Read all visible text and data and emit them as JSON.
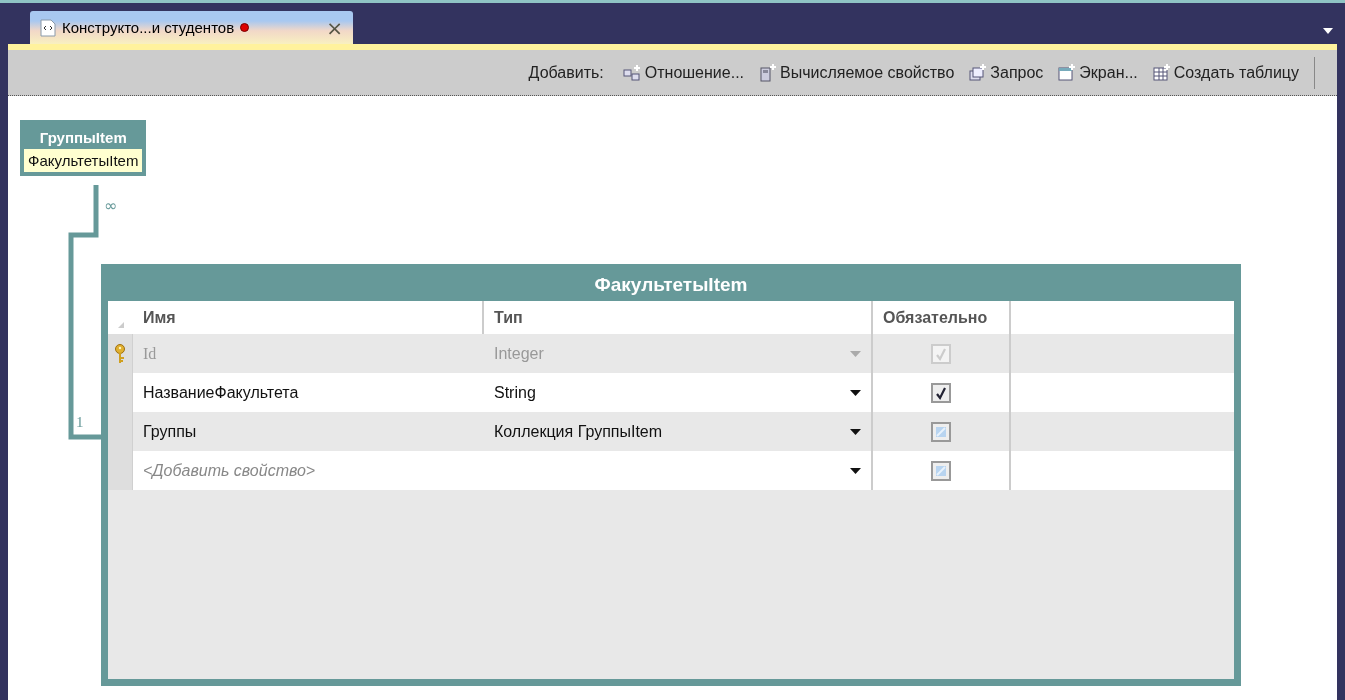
{
  "tab": {
    "title": "Конструкто...и студентов",
    "modified": true,
    "close": "×"
  },
  "toolbar": {
    "label": "Добавить:",
    "buttons": [
      {
        "kind": "relation",
        "label": "Отношение..."
      },
      {
        "kind": "computed",
        "label": "Вычисляемое свойство"
      },
      {
        "kind": "query",
        "label": "Запрос"
      },
      {
        "kind": "screen",
        "label": "Экран..."
      },
      {
        "kind": "table",
        "label": "Создать таблицу"
      }
    ]
  },
  "related_entity": {
    "title": "ГруппыItem",
    "property": "ФакультетыItem",
    "many_label": "∞",
    "one_label": "1"
  },
  "entity": {
    "title": "ФакультетыItem",
    "columns": [
      "Имя",
      "Тип",
      "Обязательно"
    ],
    "rows": [
      {
        "kind": "property",
        "key": true,
        "disabled": true,
        "name": "Id",
        "type": "Integer",
        "required": true
      },
      {
        "kind": "property",
        "key": false,
        "disabled": false,
        "name": "НазваниеФакультета",
        "type": "String",
        "required": true
      },
      {
        "kind": "property",
        "key": false,
        "disabled": false,
        "name": "Группы",
        "type": "Коллекция ГруппыItem",
        "required": false
      },
      {
        "kind": "placeholder",
        "key": false,
        "disabled": false,
        "name": "<Добавить свойство>",
        "type": "",
        "required": false
      }
    ]
  }
}
